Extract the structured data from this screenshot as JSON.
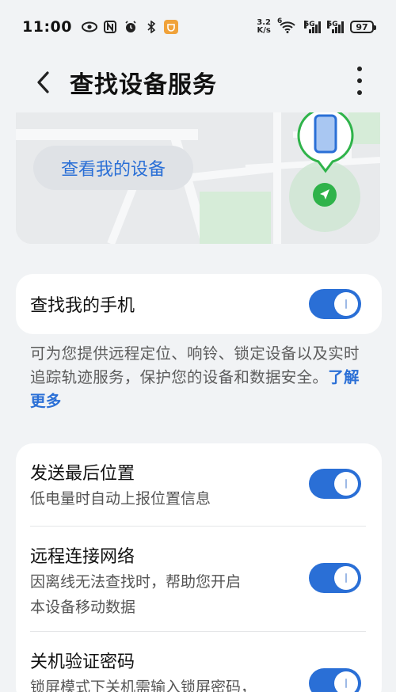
{
  "status": {
    "time": "11:00",
    "net_speed_value": "3.2",
    "net_speed_unit": "K/s",
    "wifi_label": "6",
    "signal1_label": "5G",
    "signal2_label": "5G",
    "battery": "97"
  },
  "header": {
    "title": "查找设备服务"
  },
  "map": {
    "view_device_label": "查看我的设备"
  },
  "find_phone": {
    "title": "查找我的手机",
    "enabled": true
  },
  "intro": {
    "text": "可为您提供远程定位、响铃、锁定设备以及实时追踪轨迹服务，保护您的设备和数据安全。",
    "link": "了解更多"
  },
  "settings": [
    {
      "title": "发送最后位置",
      "desc": "低电量时自动上报位置信息",
      "enabled": true
    },
    {
      "title": "远程连接网络",
      "desc_line1": "因离线无法查找时，帮助您开启",
      "desc_line2": "本设备移动数据",
      "enabled": true
    },
    {
      "title": "关机验证密码",
      "desc": "锁屏模式下关机需输入锁屏密码，",
      "enabled": true
    }
  ],
  "colors": {
    "accent": "#2a6fd6",
    "background": "#f1f3f5",
    "map_green": "#2fb34a"
  }
}
